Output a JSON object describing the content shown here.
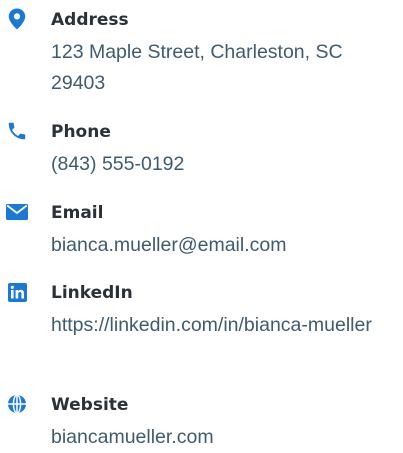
{
  "accent_color": "#1a78d6",
  "contacts": [
    {
      "icon": "map-pin-icon",
      "label": "Address",
      "value": "123 Maple Street, Charleston, SC 29403"
    },
    {
      "icon": "phone-icon",
      "label": "Phone",
      "value": "(843) 555-0192"
    },
    {
      "icon": "envelope-icon",
      "label": "Email",
      "value": "bianca.mueller@email.com"
    },
    {
      "icon": "linkedin-icon",
      "label": "LinkedIn",
      "value": "https://linkedin.com/in/bianca-mueller"
    },
    {
      "icon": "globe-icon",
      "label": "Website",
      "value": "biancamueller.com"
    }
  ]
}
